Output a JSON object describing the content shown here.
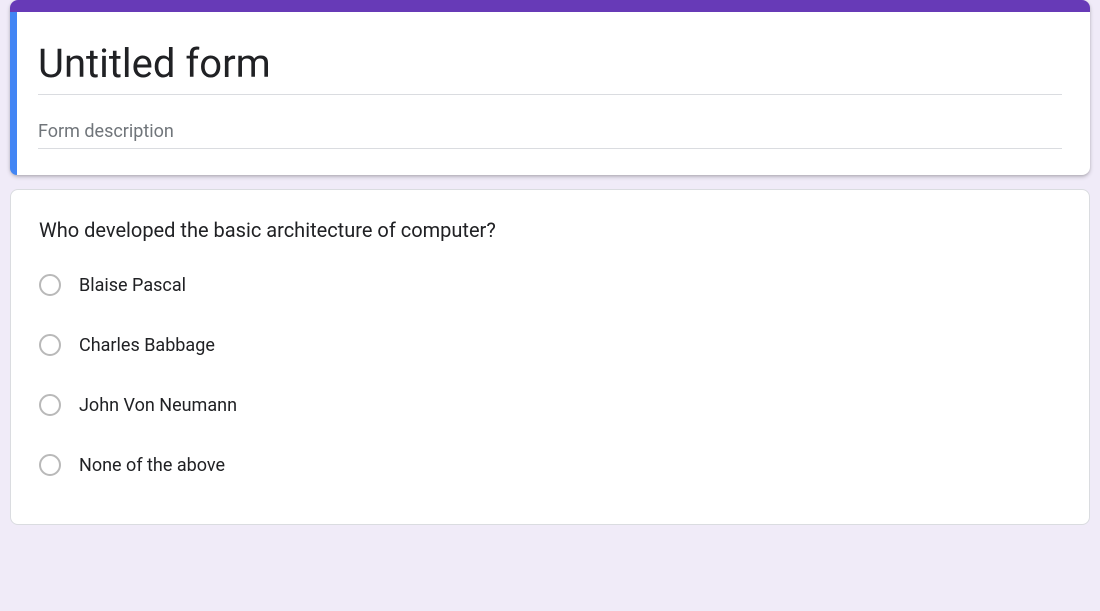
{
  "header": {
    "title": "Untitled form",
    "description_placeholder": "Form description",
    "description_value": ""
  },
  "question": {
    "text": "Who developed the basic architecture of computer?",
    "options": [
      {
        "label": "Blaise Pascal"
      },
      {
        "label": "Charles Babbage"
      },
      {
        "label": "John Von Neumann"
      },
      {
        "label": "None of the above"
      }
    ]
  },
  "colors": {
    "accent": "#673ab7",
    "selected": "#4285f4",
    "background": "#f0ebf8"
  }
}
